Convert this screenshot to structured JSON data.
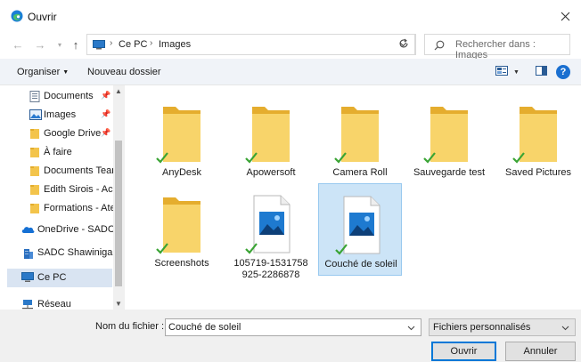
{
  "window": {
    "title": "Ouvrir",
    "app_icon": "edge-browser-icon",
    "close_icon": "close-icon"
  },
  "address": {
    "breadcrumbs": [
      "Ce PC",
      "Images"
    ],
    "search_placeholder": "Rechercher dans : Images"
  },
  "toolbar": {
    "organize_label": "Organiser",
    "new_folder_label": "Nouveau dossier",
    "help_label": "?"
  },
  "sidebar": {
    "items": [
      {
        "label": "Documents",
        "icon": "documents-icon",
        "pinned": true
      },
      {
        "label": "Images",
        "icon": "pictures-icon",
        "pinned": true
      },
      {
        "label": "Google Drive",
        "icon": "folder-icon",
        "pinned": true
      },
      {
        "label": "À faire",
        "icon": "folder-icon",
        "pinned": false
      },
      {
        "label": "Documents Tean",
        "icon": "folder-icon",
        "pinned": false
      },
      {
        "label": "Edith Sirois - Acc",
        "icon": "folder-icon",
        "pinned": false
      },
      {
        "label": "Formations - Ate",
        "icon": "folder-icon",
        "pinned": false
      },
      {
        "label": "OneDrive - SADC",
        "icon": "onedrive-icon",
        "pinned": false
      },
      {
        "label": "SADC Shawinigan",
        "icon": "building-icon",
        "pinned": false
      },
      {
        "label": "Ce PC",
        "icon": "computer-icon",
        "pinned": false
      },
      {
        "label": "Réseau",
        "icon": "network-icon",
        "pinned": false
      }
    ]
  },
  "content": {
    "items": [
      {
        "name": "AnyDesk",
        "type": "folder",
        "synced": true
      },
      {
        "name": "Apowersoft",
        "type": "folder",
        "synced": true
      },
      {
        "name": "Camera Roll",
        "type": "folder",
        "synced": true
      },
      {
        "name": "Sauvegarde test",
        "type": "folder",
        "synced": true
      },
      {
        "name": "Saved Pictures",
        "type": "folder",
        "synced": true
      },
      {
        "name": "Screenshots",
        "type": "folder",
        "synced": true
      },
      {
        "name": "105719-1531758925-2286878",
        "line1": "105719-1531758",
        "line2": "925-2286878",
        "type": "image",
        "synced": true
      },
      {
        "name": "Couché de soleil",
        "type": "image",
        "synced": true,
        "selected": true
      }
    ]
  },
  "footer": {
    "filename_label": "Nom du fichier :",
    "filename_value": "Couché de soleil",
    "filetype_value": "Fichiers personnalisés",
    "open_label": "Ouvrir",
    "cancel_label": "Annuler"
  },
  "colors": {
    "accent": "#0078d7",
    "selection": "#cce4f7",
    "folder": "#f5c94e",
    "sync_check": "#3aa434"
  }
}
